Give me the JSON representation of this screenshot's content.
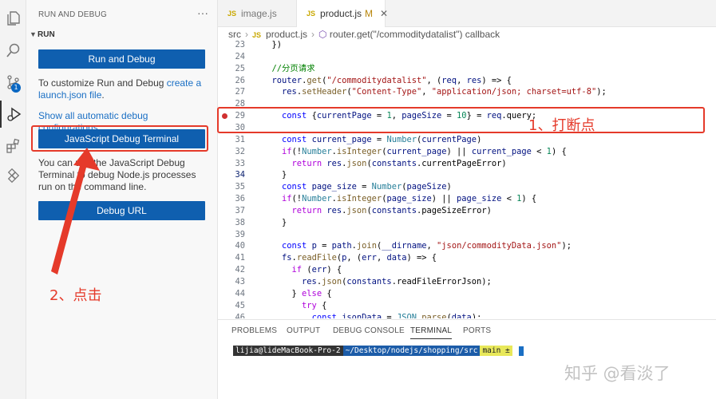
{
  "sidebar": {
    "title": "RUN AND DEBUG",
    "more": "···",
    "section": "RUN",
    "run_button": "Run and Debug",
    "customize_text": "To customize Run and Debug ",
    "customize_link": "create a launch.json file",
    "customize_end": ".",
    "show_all_link": "Show all automatic debug configurations.",
    "js_debug_button": "JavaScript Debug Terminal",
    "js_debug_desc": "You can use the JavaScript Debug Terminal to debug Node.js processes run on the command line.",
    "debug_url_button": "Debug URL"
  },
  "activity": {
    "scm_badge": "1"
  },
  "tabs": [
    {
      "icon": "JS",
      "label": "image.js",
      "modified": ""
    },
    {
      "icon": "JS",
      "label": "product.js",
      "modified": "M",
      "close": "✕"
    }
  ],
  "breadcrumb": {
    "folder": "src",
    "file": "product.js",
    "symbol": "router.get(\"/commoditydatalist\") callback"
  },
  "editor": {
    "lines": [
      {
        "n": "23",
        "text": "  })"
      },
      {
        "n": "24",
        "text": ""
      },
      {
        "n": "25",
        "text": "  //分页请求"
      },
      {
        "n": "26",
        "text": "  router.get(\"/commoditydatalist\", (req, res) => {"
      },
      {
        "n": "27",
        "text": "    res.setHeader(\"Content-Type\", \"application/json; charset=utf-8\");"
      },
      {
        "n": "28",
        "text": ""
      },
      {
        "n": "29",
        "text": "    const {currentPage = 1, pageSize = 10} = req.query;"
      },
      {
        "n": "30",
        "text": ""
      },
      {
        "n": "31",
        "text": "    const current_page = Number(currentPage)"
      },
      {
        "n": "32",
        "text": "    if(!Number.isInteger(current_page) || current_page < 1) {"
      },
      {
        "n": "33",
        "text": "      return res.json(constants.currentPageError)"
      },
      {
        "n": "34",
        "text": "    }"
      },
      {
        "n": "35",
        "text": "    const page_size = Number(pageSize)"
      },
      {
        "n": "36",
        "text": "    if(!Number.isInteger(page_size) || page_size < 1) {"
      },
      {
        "n": "37",
        "text": "      return res.json(constants.pageSizeError)"
      },
      {
        "n": "38",
        "text": "    }"
      },
      {
        "n": "39",
        "text": ""
      },
      {
        "n": "40",
        "text": "    const p = path.join(__dirname, \"json/commodityData.json\");"
      },
      {
        "n": "41",
        "text": "    fs.readFile(p, (err, data) => {"
      },
      {
        "n": "42",
        "text": "      if (err) {"
      },
      {
        "n": "43",
        "text": "        res.json(constants.readFileErrorJson);"
      },
      {
        "n": "44",
        "text": "      } else {"
      },
      {
        "n": "45",
        "text": "        try {"
      },
      {
        "n": "46",
        "text": "          const jsonData = JSON.parse(data);"
      }
    ],
    "breakpoint_line": "29",
    "current_line": "34"
  },
  "panel": {
    "tabs": [
      "PROBLEMS",
      "OUTPUT",
      "DEBUG CONSOLE",
      "TERMINAL",
      "PORTS"
    ],
    "active_tab": "TERMINAL",
    "prompt_user": " lijia@lideMacBook-Pro-2 ",
    "prompt_path": " ~/Desktop/nodejs/shopping/src ",
    "prompt_git": "  main ± "
  },
  "annotations": {
    "step1": "1、打断点",
    "step2": "2、点击"
  },
  "watermark": "知乎 @看淡了",
  "colors": {
    "accent": "#0f5faf",
    "annotation": "#e53a2a",
    "breakpoint": "#d03030"
  }
}
